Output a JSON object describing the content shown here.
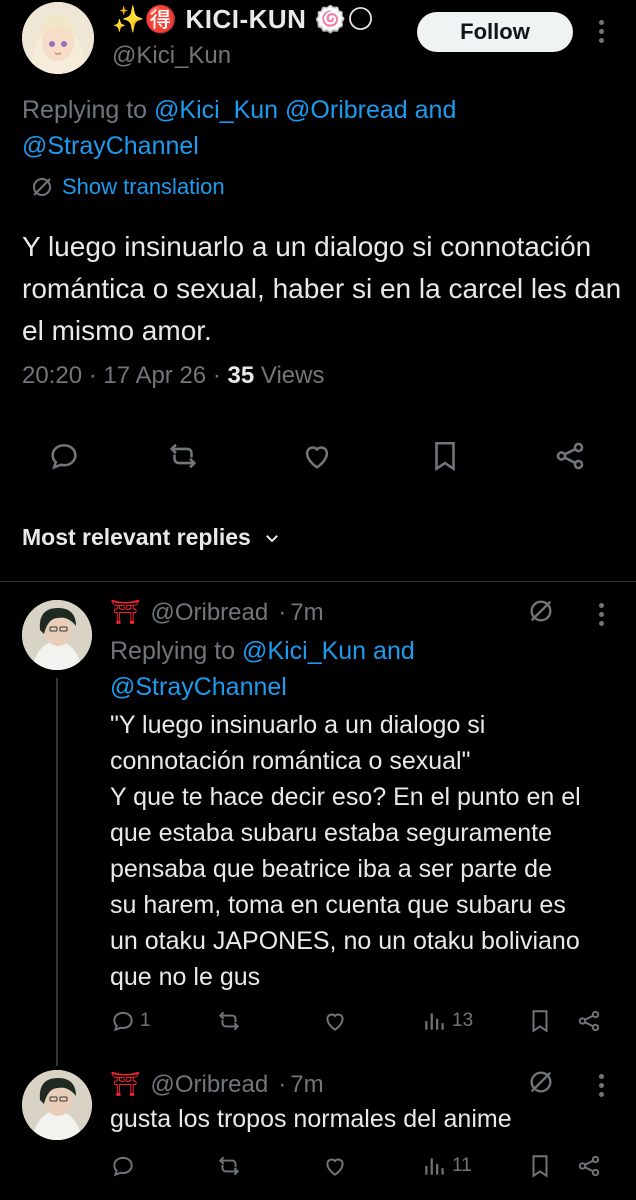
{
  "main_tweet": {
    "display_name": "✨🉐 KICI-KUN 🍥🌕",
    "handle": "@Kici_Kun",
    "follow_label": "Follow",
    "replying_prefix": "Replying to",
    "replying_user1": "@Kici_Kun",
    "replying_user2": "@Oribread",
    "replying_and": "and",
    "replying_user3": "@StrayChannel",
    "show_translation": "Show translation",
    "text": "Y luego insinuarlo a un dialogo si connotación romántica o sexual, haber si en la carcel les dan el mismo amor.",
    "time": "20:20",
    "date": "17 Apr 26",
    "views_count": "35",
    "views_label": "Views"
  },
  "sort": {
    "label": "Most relevant replies"
  },
  "replies": [
    {
      "icon_prefix": "⛩",
      "handle": "@Oribread",
      "time": "7m",
      "replying_prefix": "Replying to",
      "replying_user1": "@Kici_Kun",
      "replying_and": "and",
      "replying_user2": "@StrayChannel",
      "text_lines": [
        "\"Y luego insinuarlo a un dialogo si",
        "connotación romántica o sexual\"",
        "Y que te hace decir eso? En el punto en el",
        "que estaba subaru estaba seguramente",
        "pensaba que beatrice iba a ser parte de",
        "su harem, toma en cuenta que subaru es",
        "un otaku JAPONES, no un otaku boliviano",
        "que no le gus"
      ],
      "reply_count": "1",
      "views_count": "13"
    },
    {
      "icon_prefix": "⛩",
      "handle": "@Oribread",
      "time": "7m",
      "text": "gusta los tropos normales del anime",
      "views_count": "11"
    }
  ],
  "icons": {
    "reply": "reply-icon",
    "retweet": "retweet-icon",
    "like": "heart-icon",
    "bookmark": "bookmark-icon",
    "share": "share-icon",
    "translate": "translate-icon",
    "views": "views-icon",
    "more": "more-icon",
    "chevron": "chevron-down-icon"
  },
  "colors": {
    "background": "#000000",
    "text": "#e7e9ea",
    "muted": "#71767b",
    "link": "#1d9bf0",
    "torii": "#f4212e"
  }
}
